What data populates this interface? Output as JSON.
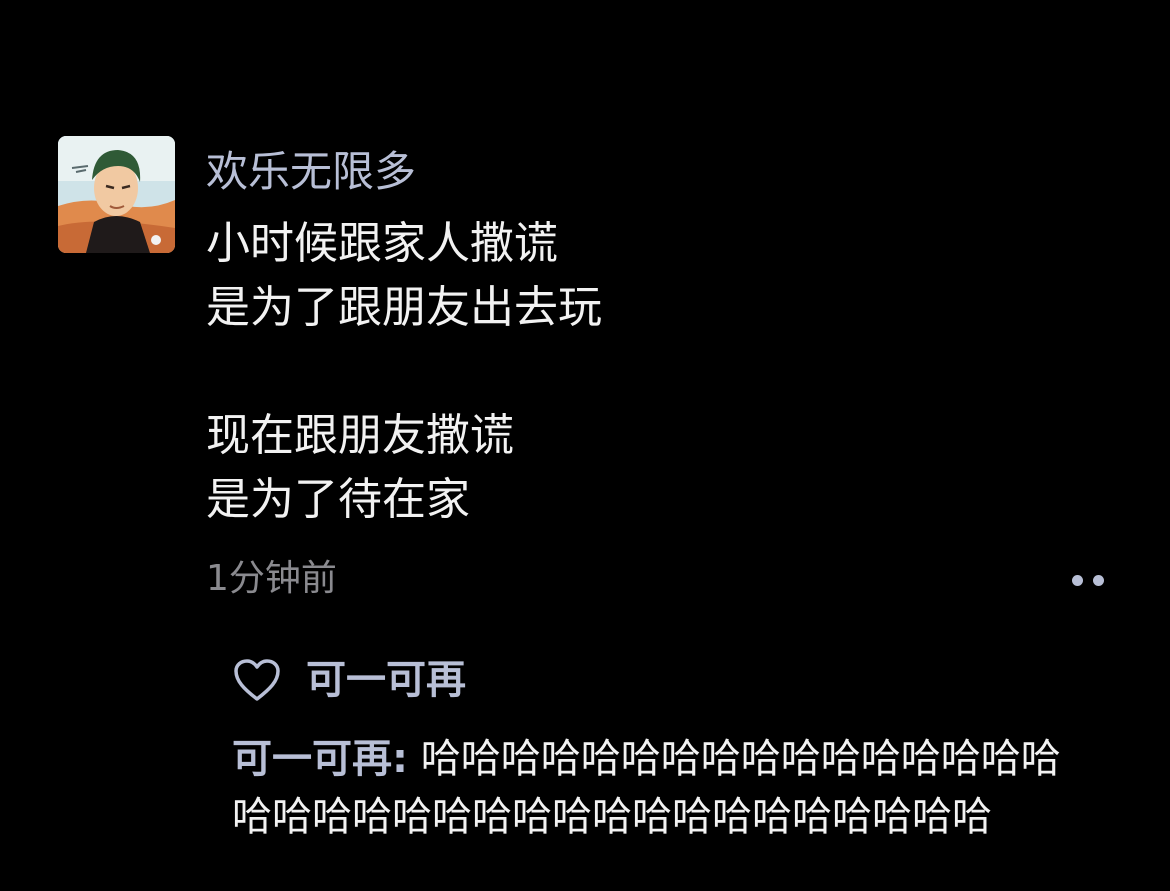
{
  "post": {
    "author_name": "欢乐无限多",
    "avatar_icon": "anime-character-avatar",
    "content_lines": [
      "小时候跟家人撒谎",
      "是为了跟朋友出去玩",
      "",
      "现在跟朋友撒谎",
      "是为了待在家"
    ],
    "timestamp": "1分钟前"
  },
  "actions": {
    "more_icon": "more-dots-icon",
    "like_icon": "heart-icon"
  },
  "likes": {
    "names": "可一可再"
  },
  "comment": {
    "author": "可一可再:",
    "text_line1": " 哈哈哈哈哈哈哈哈哈哈哈哈哈哈哈哈",
    "text_line2": "哈哈哈哈哈哈哈哈哈哈哈哈哈哈哈哈哈哈哈"
  },
  "colors": {
    "background": "#000000",
    "name_blue": "#b8bfd6",
    "text": "#f2f2f2",
    "muted": "#8a8a8f"
  }
}
